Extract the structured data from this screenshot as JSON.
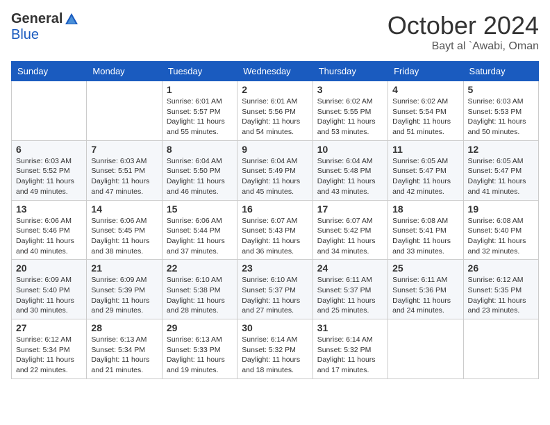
{
  "header": {
    "logo_general": "General",
    "logo_blue": "Blue",
    "month_title": "October 2024",
    "location": "Bayt al `Awabi, Oman"
  },
  "weekdays": [
    "Sunday",
    "Monday",
    "Tuesday",
    "Wednesday",
    "Thursday",
    "Friday",
    "Saturday"
  ],
  "weeks": [
    [
      {
        "day": "",
        "info": ""
      },
      {
        "day": "",
        "info": ""
      },
      {
        "day": "1",
        "info": "Sunrise: 6:01 AM\nSunset: 5:57 PM\nDaylight: 11 hours and 55 minutes."
      },
      {
        "day": "2",
        "info": "Sunrise: 6:01 AM\nSunset: 5:56 PM\nDaylight: 11 hours and 54 minutes."
      },
      {
        "day": "3",
        "info": "Sunrise: 6:02 AM\nSunset: 5:55 PM\nDaylight: 11 hours and 53 minutes."
      },
      {
        "day": "4",
        "info": "Sunrise: 6:02 AM\nSunset: 5:54 PM\nDaylight: 11 hours and 51 minutes."
      },
      {
        "day": "5",
        "info": "Sunrise: 6:03 AM\nSunset: 5:53 PM\nDaylight: 11 hours and 50 minutes."
      }
    ],
    [
      {
        "day": "6",
        "info": "Sunrise: 6:03 AM\nSunset: 5:52 PM\nDaylight: 11 hours and 49 minutes."
      },
      {
        "day": "7",
        "info": "Sunrise: 6:03 AM\nSunset: 5:51 PM\nDaylight: 11 hours and 47 minutes."
      },
      {
        "day": "8",
        "info": "Sunrise: 6:04 AM\nSunset: 5:50 PM\nDaylight: 11 hours and 46 minutes."
      },
      {
        "day": "9",
        "info": "Sunrise: 6:04 AM\nSunset: 5:49 PM\nDaylight: 11 hours and 45 minutes."
      },
      {
        "day": "10",
        "info": "Sunrise: 6:04 AM\nSunset: 5:48 PM\nDaylight: 11 hours and 43 minutes."
      },
      {
        "day": "11",
        "info": "Sunrise: 6:05 AM\nSunset: 5:47 PM\nDaylight: 11 hours and 42 minutes."
      },
      {
        "day": "12",
        "info": "Sunrise: 6:05 AM\nSunset: 5:47 PM\nDaylight: 11 hours and 41 minutes."
      }
    ],
    [
      {
        "day": "13",
        "info": "Sunrise: 6:06 AM\nSunset: 5:46 PM\nDaylight: 11 hours and 40 minutes."
      },
      {
        "day": "14",
        "info": "Sunrise: 6:06 AM\nSunset: 5:45 PM\nDaylight: 11 hours and 38 minutes."
      },
      {
        "day": "15",
        "info": "Sunrise: 6:06 AM\nSunset: 5:44 PM\nDaylight: 11 hours and 37 minutes."
      },
      {
        "day": "16",
        "info": "Sunrise: 6:07 AM\nSunset: 5:43 PM\nDaylight: 11 hours and 36 minutes."
      },
      {
        "day": "17",
        "info": "Sunrise: 6:07 AM\nSunset: 5:42 PM\nDaylight: 11 hours and 34 minutes."
      },
      {
        "day": "18",
        "info": "Sunrise: 6:08 AM\nSunset: 5:41 PM\nDaylight: 11 hours and 33 minutes."
      },
      {
        "day": "19",
        "info": "Sunrise: 6:08 AM\nSunset: 5:40 PM\nDaylight: 11 hours and 32 minutes."
      }
    ],
    [
      {
        "day": "20",
        "info": "Sunrise: 6:09 AM\nSunset: 5:40 PM\nDaylight: 11 hours and 30 minutes."
      },
      {
        "day": "21",
        "info": "Sunrise: 6:09 AM\nSunset: 5:39 PM\nDaylight: 11 hours and 29 minutes."
      },
      {
        "day": "22",
        "info": "Sunrise: 6:10 AM\nSunset: 5:38 PM\nDaylight: 11 hours and 28 minutes."
      },
      {
        "day": "23",
        "info": "Sunrise: 6:10 AM\nSunset: 5:37 PM\nDaylight: 11 hours and 27 minutes."
      },
      {
        "day": "24",
        "info": "Sunrise: 6:11 AM\nSunset: 5:37 PM\nDaylight: 11 hours and 25 minutes."
      },
      {
        "day": "25",
        "info": "Sunrise: 6:11 AM\nSunset: 5:36 PM\nDaylight: 11 hours and 24 minutes."
      },
      {
        "day": "26",
        "info": "Sunrise: 6:12 AM\nSunset: 5:35 PM\nDaylight: 11 hours and 23 minutes."
      }
    ],
    [
      {
        "day": "27",
        "info": "Sunrise: 6:12 AM\nSunset: 5:34 PM\nDaylight: 11 hours and 22 minutes."
      },
      {
        "day": "28",
        "info": "Sunrise: 6:13 AM\nSunset: 5:34 PM\nDaylight: 11 hours and 21 minutes."
      },
      {
        "day": "29",
        "info": "Sunrise: 6:13 AM\nSunset: 5:33 PM\nDaylight: 11 hours and 19 minutes."
      },
      {
        "day": "30",
        "info": "Sunrise: 6:14 AM\nSunset: 5:32 PM\nDaylight: 11 hours and 18 minutes."
      },
      {
        "day": "31",
        "info": "Sunrise: 6:14 AM\nSunset: 5:32 PM\nDaylight: 11 hours and 17 minutes."
      },
      {
        "day": "",
        "info": ""
      },
      {
        "day": "",
        "info": ""
      }
    ]
  ]
}
